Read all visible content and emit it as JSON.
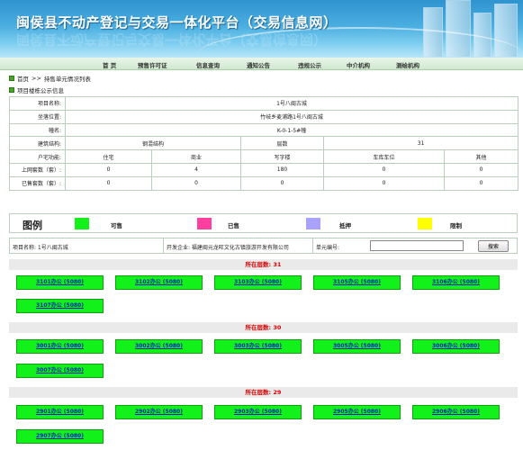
{
  "header": {
    "title": "闽侯县不动产登记与交易一体化平台（交易信息网）"
  },
  "nav": {
    "items": [
      "首 页",
      "预售许可证",
      "信息查询",
      "通知公告",
      "违规公示",
      "中介机构",
      "测绘机构"
    ]
  },
  "breadcrumb": {
    "home": "首页",
    "separator": ">>",
    "current": "持售单元情况列表"
  },
  "section_title": "项目楼栋公示信息",
  "info": {
    "project_name_label": "项目名称:",
    "project_name": "1号八闽古城",
    "location_label": "坐落位置:",
    "location": "竹岐乡麦浦路1号八闽古城",
    "building_label": "幢名:",
    "building": "K-0-1-5#幢",
    "structure_label": "建筑结构:",
    "structure": "钢混结构",
    "floors_label": "层数",
    "floors": "31",
    "usage_label": "户宅功能:",
    "usage_types": [
      "住宅",
      "商业",
      "写字楼",
      "车库车位",
      "其他"
    ],
    "online_label": "上网套数（套）:",
    "online_counts": [
      "0",
      "4",
      "180",
      "0",
      "0"
    ],
    "sold_label": "已售套数（套）:",
    "sold_counts": [
      "0",
      "0",
      "0",
      "0",
      "0"
    ]
  },
  "legend": {
    "title": "图例",
    "items": [
      {
        "label": "可售",
        "color": "#12f21a"
      },
      {
        "label": "已售",
        "color": "#ff3fa0"
      },
      {
        "label": "抵押",
        "color": "#a9a2ff"
      },
      {
        "label": "限制",
        "color": "#ffff00"
      }
    ]
  },
  "filter": {
    "project_label": "项目名称: 1号八闽古城",
    "developer_label": "开发企业: 福建闽元龙旺文化古镇旅游开发有限公司",
    "unit_no_label": "单元编号:",
    "unit_no_value": "",
    "search_button": "搜索"
  },
  "floors": [
    {
      "label": "所在层数: 31",
      "units": [
        "3101办公 (5080)",
        "3102办公 (5080)",
        "3103办公 (5080)",
        "3105办公 (5080)",
        "3106办公 (5080)",
        "3107办公 (5080)"
      ]
    },
    {
      "label": "所在层数: 30",
      "units": [
        "3001办公 (5080)",
        "3002办公 (5080)",
        "3003办公 (5080)",
        "3005办公 (5080)",
        "3006办公 (5080)",
        "3007办公 (5080)"
      ]
    },
    {
      "label": "所在层数: 29",
      "units": [
        "2901办公 (5080)",
        "2902办公 (5080)",
        "2903办公 (5080)",
        "2905办公 (5080)",
        "2906办公 (5080)",
        "2907办公 (5080)"
      ]
    }
  ]
}
